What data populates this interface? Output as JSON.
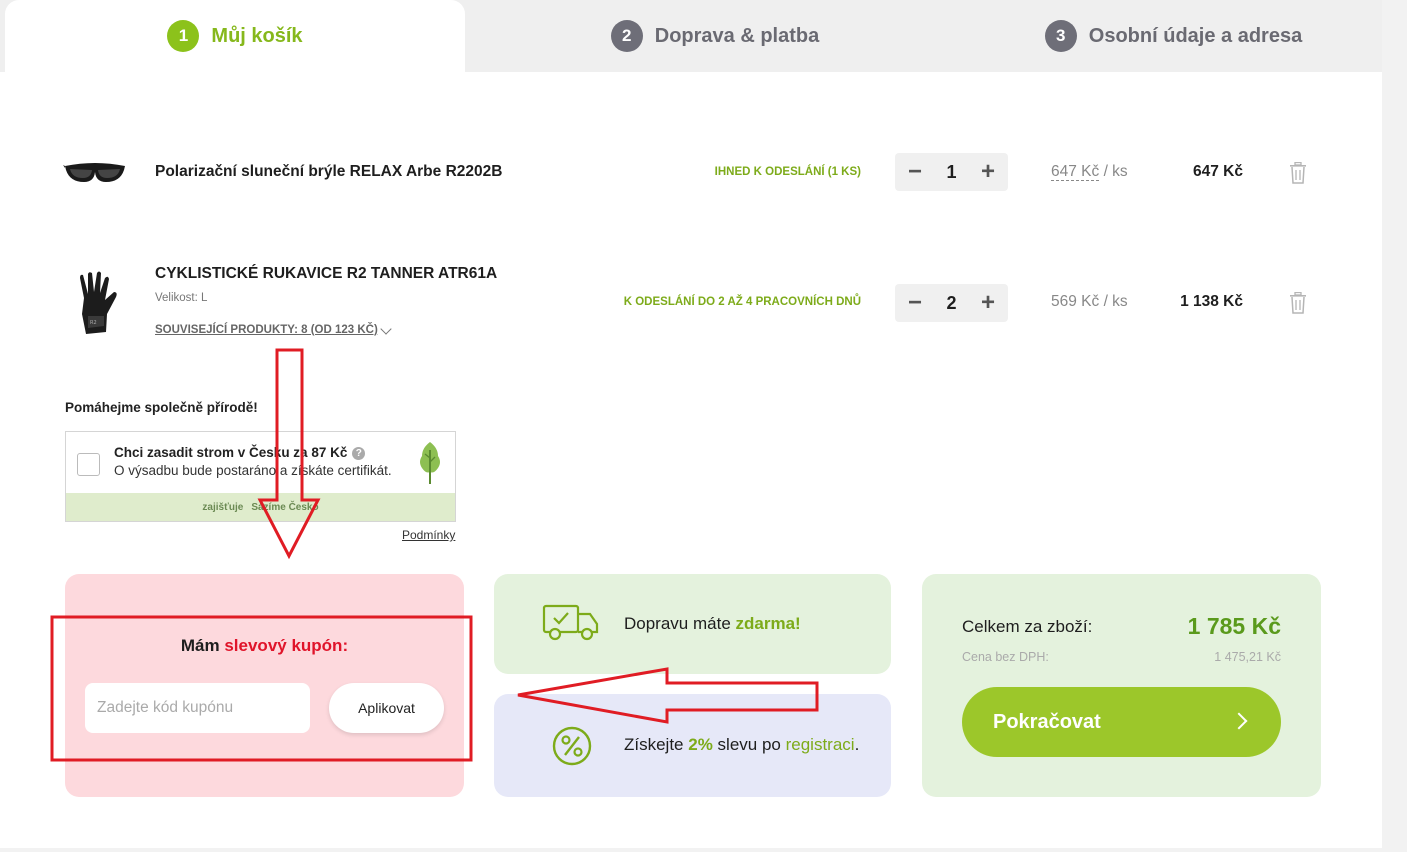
{
  "steps": [
    {
      "num": "1",
      "label": "Můj košík"
    },
    {
      "num": "2",
      "label": "Doprava & platba"
    },
    {
      "num": "3",
      "label": "Osobní údaje a adresa"
    }
  ],
  "items": [
    {
      "name": "Polarizační sluneční brýle RELAX Arbe R2202B",
      "availability": "IHNED K ODESLÁNÍ (1 KS)",
      "qty": "1",
      "unit_price": "647 Kč",
      "unit_suffix": " / ks",
      "total": "647 Kč"
    },
    {
      "name": "CYKLISTICKÉ RUKAVICE R2 TANNER ATR61A",
      "size": "Velikost: L",
      "related": "SOUVISEJÍCÍ PRODUKTY: 8 (OD 123 KČ)",
      "availability": "K ODESLÁNÍ DO 2 AŽ 4 PRACOVNÍCH DNŮ",
      "qty": "2",
      "unit_price": "569 Kč",
      "unit_suffix": " / ks",
      "total": "1 138 Kč"
    }
  ],
  "qty_controls": {
    "minus": "−",
    "plus": "+"
  },
  "nature": {
    "title": "Pomáhejme společně přírodě!",
    "checkbox_label": "Chci zasadit strom v Česku za 87 Kč",
    "help": "?",
    "description": "O výsadbu bude postaráno a získáte certifikát.",
    "provided_by": "zajišťuje",
    "partner": "Sázíme Česko",
    "conditions": "Podmínky"
  },
  "coupon": {
    "title_prefix": "Mám ",
    "title_highlight": "slevový kupón:",
    "placeholder": "Zadejte kód kupónu",
    "apply_label": "Aplikovat"
  },
  "shipping": {
    "text_prefix": "Dopravu máte ",
    "text_highlight": "zdarma!"
  },
  "discount": {
    "text_prefix": "Získejte ",
    "percent": "2%",
    "text_middle": " slevu po ",
    "link": "registraci",
    "text_suffix": "."
  },
  "summary": {
    "total_label": "Celkem za zboží:",
    "total_value": "1 785 Kč",
    "vat_label": "Cena bez DPH:",
    "vat_value": "1 475,21 Kč",
    "continue_label": "Pokračovat"
  },
  "colors": {
    "accent_green": "#8cc21b",
    "coupon_bg": "#fdd9dd",
    "annotation_red": "#e01c24"
  }
}
